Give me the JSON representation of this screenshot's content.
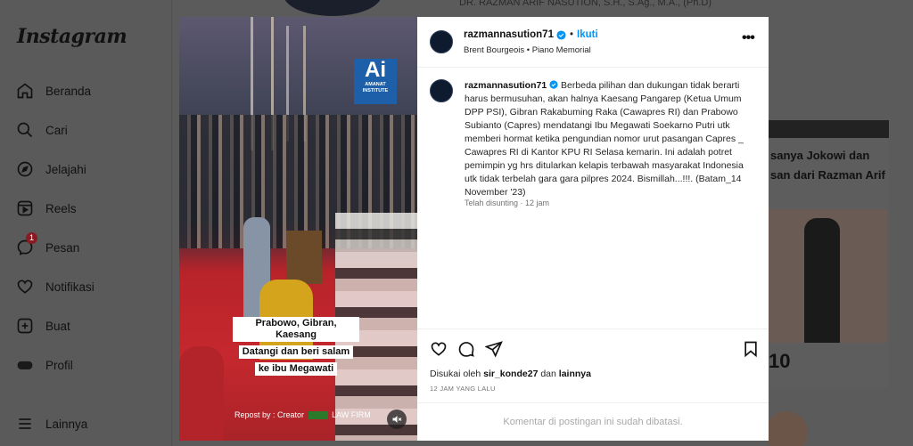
{
  "sidebar": {
    "logo": "Instagram",
    "items": [
      {
        "label": "Beranda",
        "icon": "home-icon"
      },
      {
        "label": "Cari",
        "icon": "search-icon"
      },
      {
        "label": "Jelajahi",
        "icon": "compass-icon"
      },
      {
        "label": "Reels",
        "icon": "reels-icon"
      },
      {
        "label": "Pesan",
        "icon": "messenger-icon",
        "badge": "1"
      },
      {
        "label": "Notifikasi",
        "icon": "heart-icon"
      },
      {
        "label": "Buat",
        "icon": "plus-square-icon"
      },
      {
        "label": "Profil",
        "icon": "profile-icon"
      },
      {
        "label": "Lainnya",
        "icon": "menu-icon"
      }
    ]
  },
  "background": {
    "top_text": "DR. RAZMAN ARIF NASUTION, S.H., S.Ag., M.A., (Ph.D)",
    "headline_1": "sanya Jokowi dan",
    "headline_2": "san dari Razman Arif",
    "big_number": "10"
  },
  "media": {
    "logo_big": "Ai",
    "logo_small_1": "AMANAT",
    "logo_small_2": "INSTITUTE",
    "caption_lines": [
      "Prabowo, Gibran, Kaesang",
      "Datangi dan beri salam",
      "ke ibu Megawati"
    ],
    "repost": "Repost by : Creator",
    "repost_suffix": "LAW FIRM"
  },
  "post": {
    "username": "razmannasution71",
    "follow": "Ikuti",
    "music": "Brent Bourgeois • Piano Memorial",
    "caption": "Berbeda pilihan dan dukungan tidak berarti harus bermusuhan, akan halnya Kaesang Pangarep (Ketua Umum DPP PSI), Gibran Rakabuming Raka (Cawapres RI) dan Prabowo Subianto (Capres) mendatangi Ibu Megawati Soekarno Putri utk memberi hormat ketika pengundian nomor urut pasangan Capres _ Cawapres RI di Kantor KPU RI Selasa kemarin. Ini adalah potret pemimpin yg hrs ditularkan kelapis terbawah masyarakat Indonesia utk tidak terbelah gara gara pilpres 2024. Bismillah...!!!. (Batam_14 November '23)",
    "edited": "Telah disunting · 12 jam",
    "likes_prefix": "Disukai oleh",
    "likes_user": "sir_konde27",
    "likes_and": "dan",
    "likes_others": "lainnya",
    "time": "12 JAM YANG LALU",
    "comments_disabled": "Komentar di postingan ini sudah dibatasi."
  },
  "colors": {
    "follow_blue": "#0095f6",
    "overlay_gray": "#595959",
    "badge_red": "#8a1a22"
  }
}
